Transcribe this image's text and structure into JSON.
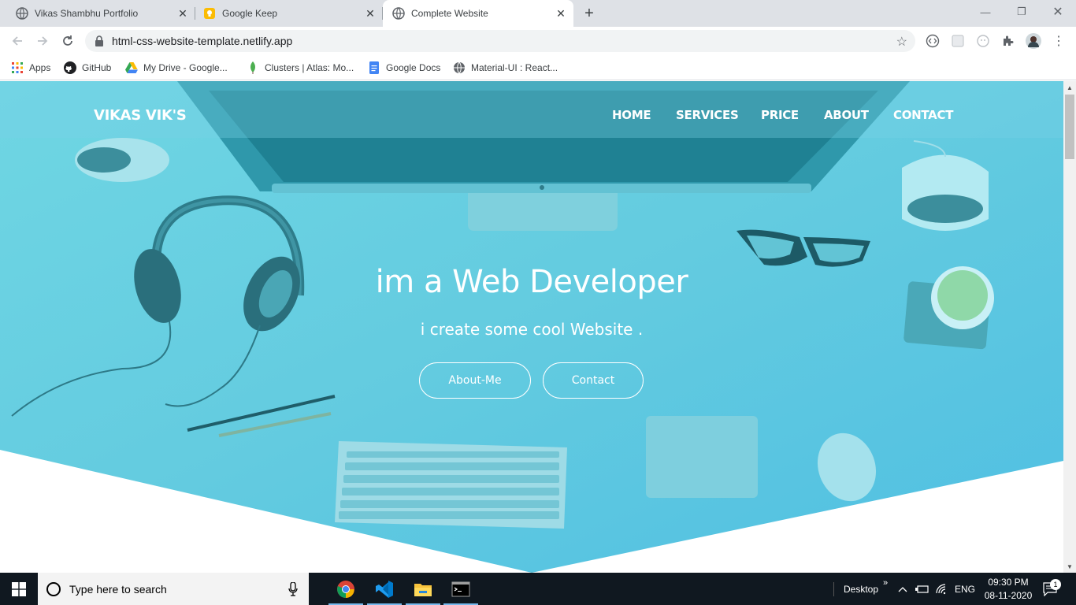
{
  "browser": {
    "tabs": [
      {
        "title": "Vikas Shambhu Portfolio",
        "icon": "globe-icon",
        "active": false
      },
      {
        "title": "Google Keep",
        "icon": "keep-icon",
        "active": false
      },
      {
        "title": "Complete Website",
        "icon": "globe-icon",
        "active": true
      }
    ],
    "url": "html-css-website-template.netlify.app",
    "bookmarks": [
      {
        "label": "Apps",
        "icon": "apps-grid-icon"
      },
      {
        "label": "GitHub",
        "icon": "github-icon"
      },
      {
        "label": "My Drive - Google...",
        "icon": "drive-icon"
      },
      {
        "label": "Clusters | Atlas: Mo...",
        "icon": "mongodb-leaf-icon"
      },
      {
        "label": "Google Docs",
        "icon": "docs-icon"
      },
      {
        "label": "Material-UI : React...",
        "icon": "globe-icon"
      }
    ]
  },
  "site": {
    "logo": "VIKAS VIK'S",
    "nav": [
      "HOME",
      "SERVICES",
      "PRICE",
      "ABOUT",
      "CONTACT"
    ],
    "headline": "im a Web Developer",
    "subheadline": "i create some cool Website .",
    "buttons": [
      "About-Me",
      "Contact"
    ]
  },
  "taskbar": {
    "search_placeholder": "Type here to search",
    "desktop_label": "Desktop",
    "chevron": "»",
    "language": "ENG",
    "time": "09:30 PM",
    "date": "08-11-2020",
    "notification_count": "1"
  },
  "colors": {
    "hero_teal": "#5ccbe0",
    "taskbar": "#101820",
    "tab_strip": "#dee1e6"
  }
}
